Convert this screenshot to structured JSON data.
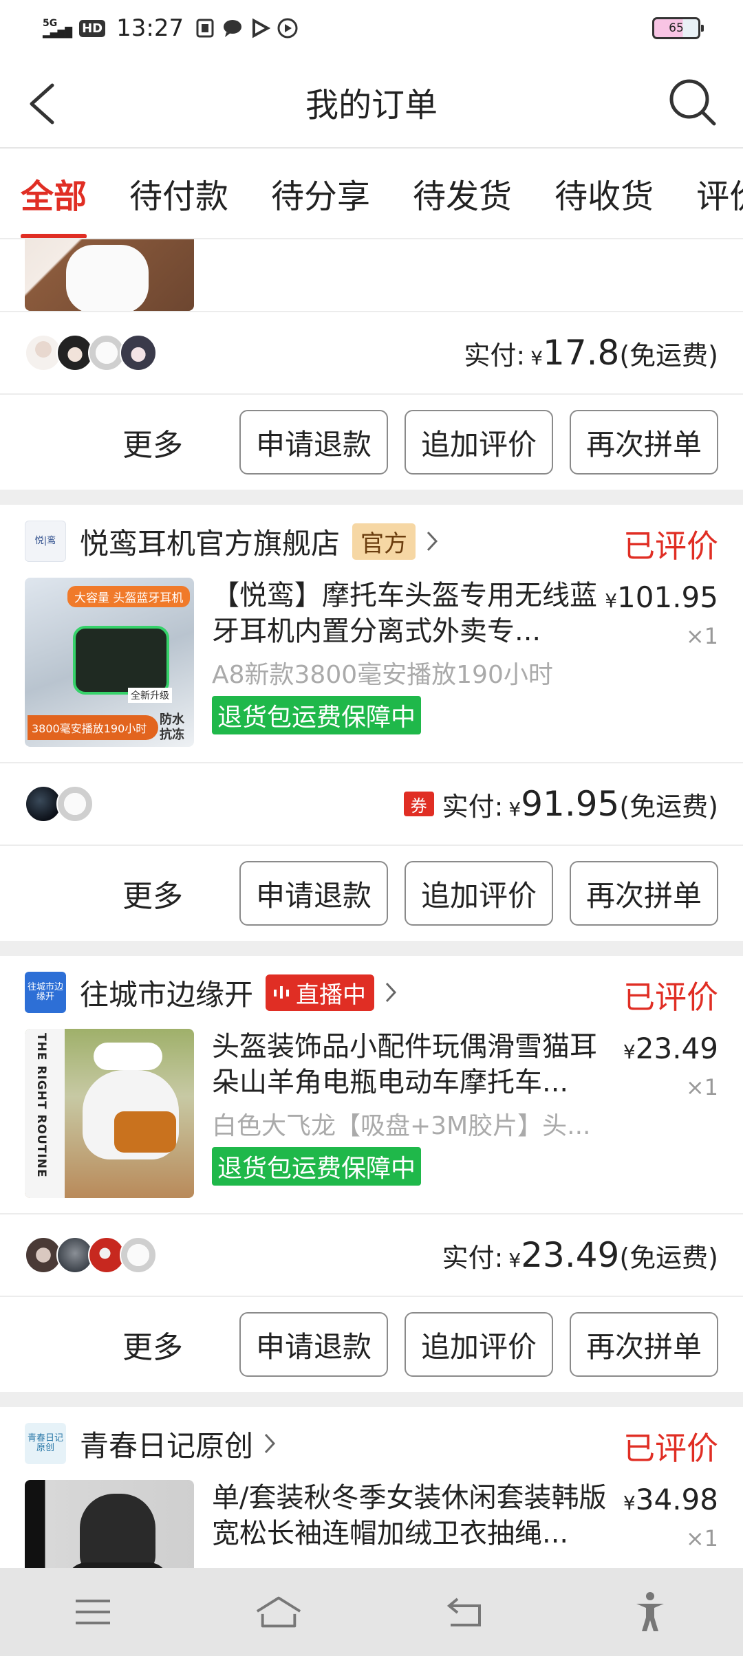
{
  "status_bar": {
    "network": "5G",
    "hd": "HD",
    "time": "13:27",
    "battery": "65",
    "icons": [
      "screenshot-icon",
      "message-icon",
      "play-icon",
      "video-icon"
    ]
  },
  "nav": {
    "title": "我的订单"
  },
  "tabs": [
    "全部",
    "待付款",
    "待分享",
    "待发货",
    "待收货",
    "评价"
  ],
  "orders": [
    {
      "pay_label": "实付:",
      "yen": "¥",
      "amount": "17.8",
      "shipping": "(免运费)",
      "more": "更多",
      "buttons": [
        "申请退款",
        "追加评价",
        "再次拼单"
      ]
    },
    {
      "store_logo": "悦|鸾",
      "store_name": "悦鸾耳机官方旗舰店",
      "store_tag": "官方",
      "status": "已评价",
      "title": "【悦鸾】摩托车头盔专用无线蓝牙耳机内置分离式外卖专...",
      "spec": "A8新款3800毫安播放190小时",
      "guarantee": "退货包运费保障中",
      "yen": "¥",
      "price": "101.95",
      "qty": "×1",
      "thumb_text": {
        "top": "大容量 头盔蓝牙耳机",
        "bottom": "3800毫安播放190小时",
        "badge": "全新升级",
        "corner": "防水抗冻"
      },
      "coupon": "券",
      "pay_label": "实付:",
      "amount": "91.95",
      "shipping": "(免运费)",
      "more": "更多",
      "buttons": [
        "申请退款",
        "追加评价",
        "再次拼单"
      ]
    },
    {
      "store_logo": "往城市边缘开",
      "store_name": "往城市边缘开",
      "store_tag": "直播中",
      "status": "已评价",
      "title": "头盔装饰品小配件玩偶滑雪猫耳朵山羊角电瓶电动车摩托车...",
      "spec": "白色大飞龙【吸盘+3M胶片】头...",
      "guarantee": "退货包运费保障中",
      "yen": "¥",
      "price": "23.49",
      "qty": "×1",
      "thumb_text": {
        "side": "THE RIGHT ROUTINE"
      },
      "pay_label": "实付:",
      "amount": "23.49",
      "shipping": "(免运费)",
      "more": "更多",
      "buttons": [
        "申请退款",
        "追加评价",
        "再次拼单"
      ]
    },
    {
      "store_logo": "青春日记原创",
      "store_name": "青春日记原创",
      "status": "已评价",
      "title": "单/套装秋冬季女装休闲套装韩版宽松长袖连帽加绒卫衣抽绳...",
      "yen": "¥",
      "price": "34.98",
      "qty": "×1"
    }
  ],
  "colors": {
    "accent": "#e02e24",
    "guarantee": "#1fb84a",
    "official_tag": "#f6d7a4"
  }
}
